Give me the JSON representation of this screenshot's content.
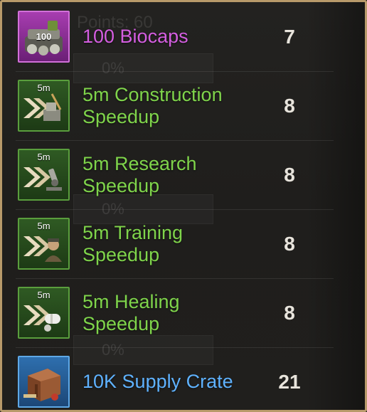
{
  "background_ghost": {
    "points_label": "Points: 60",
    "percent_labels": [
      "0%",
      "0%",
      "0%"
    ]
  },
  "colors": {
    "epic": "#d45ee0",
    "uncommon": "#7fd44b",
    "rare": "#5fb2ff",
    "quantity": "#e8e4dc",
    "frame": "#b89a6a"
  },
  "rewards": [
    {
      "name": "100 Biocaps",
      "quantity": "7",
      "rarity": "epic",
      "icon": "biocaps-icon",
      "icon_text": "100"
    },
    {
      "name": "5m Construction Speedup",
      "quantity": "8",
      "rarity": "uncommon",
      "icon": "construction-speedup-icon",
      "icon_text": "5m"
    },
    {
      "name": "5m Research Speedup",
      "quantity": "8",
      "rarity": "uncommon",
      "icon": "research-speedup-icon",
      "icon_text": "5m"
    },
    {
      "name": "5m Training Speedup",
      "quantity": "8",
      "rarity": "uncommon",
      "icon": "training-speedup-icon",
      "icon_text": "5m"
    },
    {
      "name": "5m Healing Speedup",
      "quantity": "8",
      "rarity": "uncommon",
      "icon": "healing-speedup-icon",
      "icon_text": "5m"
    },
    {
      "name": "10K Supply Crate",
      "quantity": "21",
      "rarity": "rare",
      "icon": "supply-crate-icon"
    }
  ]
}
